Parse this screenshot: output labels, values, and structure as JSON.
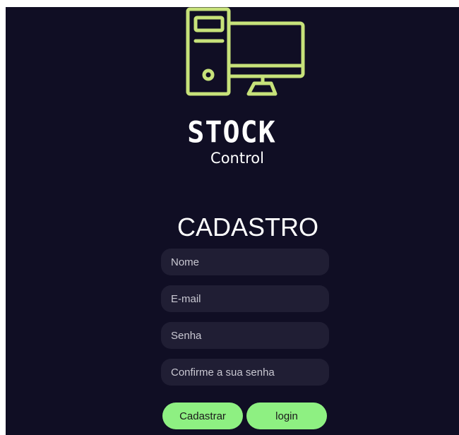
{
  "brand": {
    "name": "STOCK",
    "subtitle": "Control",
    "icon": "computer-icon",
    "accent_color": "#c7e27a"
  },
  "form": {
    "title": "CADASTRO",
    "fields": {
      "name_placeholder": "Nome",
      "email_placeholder": "E-mail",
      "password_placeholder": "Senha",
      "confirm_placeholder": "Confirme a sua senha"
    },
    "buttons": {
      "register_label": "Cadastrar",
      "login_label": "login",
      "color": "#8ef082"
    }
  },
  "theme": {
    "background": "#100e24",
    "field_background": "#201e34"
  }
}
